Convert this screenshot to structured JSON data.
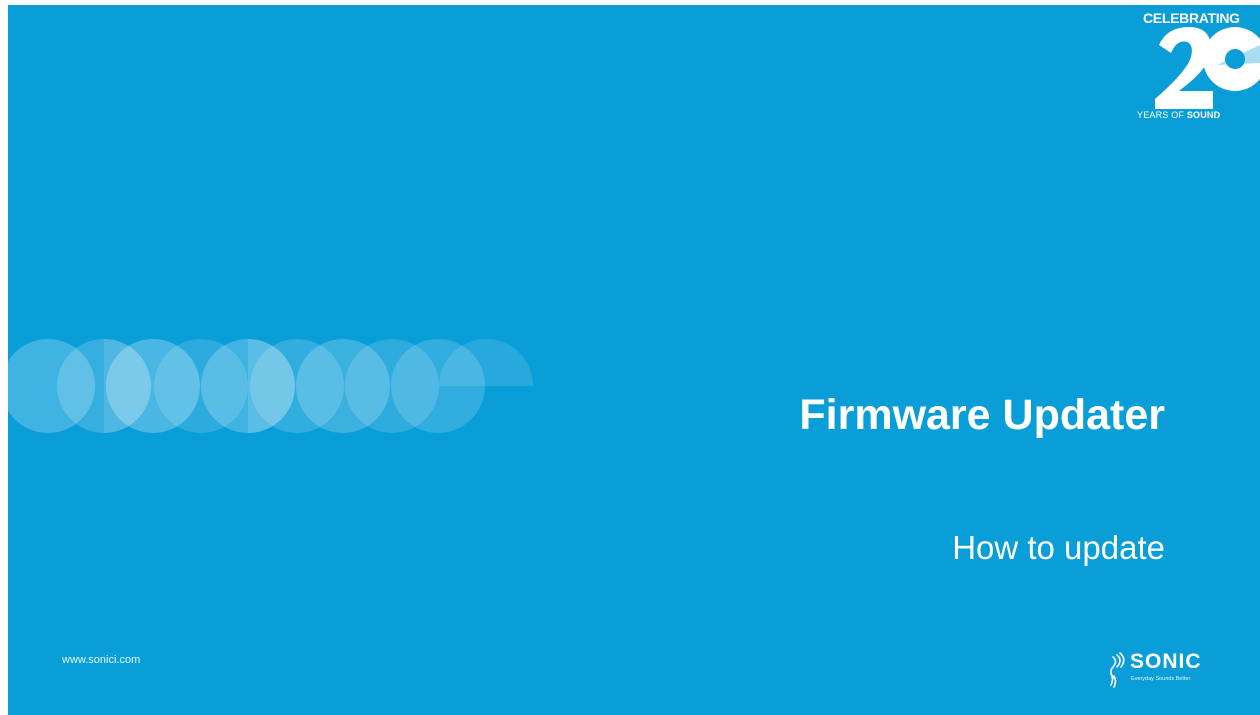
{
  "slide": {
    "title": "Firmware Updater",
    "subtitle": "How to update",
    "website": "www.sonici.com",
    "background_color": "#0a9ed9"
  },
  "badge": {
    "top_text": "CELEBRATING",
    "number": "20",
    "bottom_text_light": "YEARS OF ",
    "bottom_text_bold": "SOUND"
  },
  "brand": {
    "name": "SONIC",
    "tagline": "Everyday Sounds Better",
    "icon": "sound-waves-icon"
  }
}
